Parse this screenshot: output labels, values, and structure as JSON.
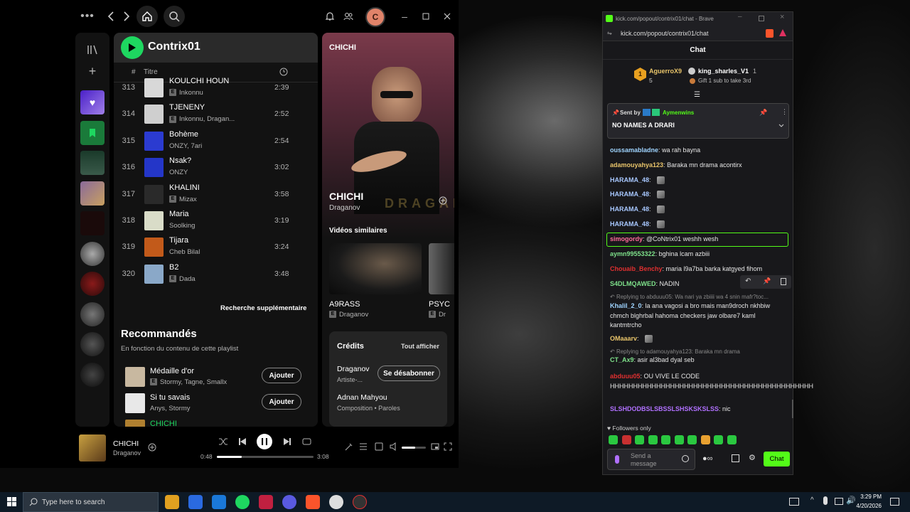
{
  "spotify": {
    "playlist_title": "Contrix01",
    "col_number": "#",
    "col_title": "Titre",
    "tracks": [
      {
        "num": "313",
        "title": "KOULCHI HOUN",
        "artist": "Inkonnu",
        "explicit": true,
        "duration": "2:39",
        "color": "#d8d8d8"
      },
      {
        "num": "314",
        "title": "TJENENY",
        "artist": "Inkonnu, Dragan...",
        "explicit": true,
        "duration": "2:52",
        "color": "#cfcfcf"
      },
      {
        "num": "315",
        "title": "Bohème",
        "artist": "ONZY, 7ari",
        "explicit": false,
        "duration": "2:54",
        "color": "#2b3bd0"
      },
      {
        "num": "316",
        "title": "Nsak?",
        "artist": "ONZY",
        "explicit": false,
        "duration": "3:02",
        "color": "#2436c8"
      },
      {
        "num": "317",
        "title": "KHALINI",
        "artist": "Mizax",
        "explicit": true,
        "duration": "3:58",
        "color": "#2a2a2a"
      },
      {
        "num": "318",
        "title": "Maria",
        "artist": "Soolking",
        "explicit": false,
        "duration": "3:19",
        "color": "#d9dcc8"
      },
      {
        "num": "319",
        "title": "Tijara",
        "artist": "Cheb Bilal",
        "explicit": false,
        "duration": "3:24",
        "color": "#c25a1a"
      },
      {
        "num": "320",
        "title": "B2",
        "artist": "Dada",
        "explicit": true,
        "duration": "3:48",
        "color": "#8aa8c8"
      }
    ],
    "more_search": "Recherche supplémentaire",
    "recommended_title": "Recommandés",
    "recommended_sub": "En fonction du contenu de cette playlist",
    "recommended": [
      {
        "title": "Médaille d'or",
        "artist": "Stormy, Tagne, Smallx",
        "explicit": true,
        "button": "Ajouter",
        "color": "#c8b8a0"
      },
      {
        "title": "Si tu savais",
        "artist": "Anys, Stormy",
        "explicit": false,
        "button": "Ajouter",
        "color": "#e8e8e8"
      },
      {
        "title": "CHICHI",
        "artist": "",
        "explicit": false,
        "button": "",
        "color": "#b08030"
      }
    ],
    "np_header": "CHICHI",
    "np_title": "CHICHI",
    "np_artist": "Draganov",
    "np_overlay_text": "DRAGANOV",
    "similar_title": "Vidéos similaires",
    "similar": [
      {
        "title": "A9RASS",
        "artist": "Draganov"
      },
      {
        "title": "PSYC",
        "artist": "Dr"
      }
    ],
    "credits_title": "Crédits",
    "credits_all": "Tout afficher",
    "credits": [
      {
        "name": "Draganov",
        "role": "Artiste-...",
        "button": "Se désabonner"
      },
      {
        "name": "Adnan Mahyou",
        "role": "Composition • Paroles",
        "button": ""
      }
    ],
    "player": {
      "title": "CHICHI",
      "artist": "Draganov",
      "elapsed": "0:48",
      "total": "3:08",
      "progress": 0.26,
      "volume": 0.55
    },
    "avatar_letter": "C"
  },
  "browser": {
    "tab_title": "kick.com/popout/contrix01/chat - Brave",
    "url": "kick.com/popout/contrix01/chat",
    "chat_title": "Chat",
    "leader1": {
      "rank": "1",
      "name": "AguerroX9",
      "count": "5"
    },
    "leader2": {
      "name": "king_sharles_V1",
      "count": "1",
      "note": "Gift 1 sub to take 3rd"
    },
    "pinned": {
      "sent_by": "Sent by",
      "author": "Aymenwins",
      "text": "NO NAMES A DRARI"
    },
    "messages": [
      {
        "user": "oussamabladne",
        "color": "#9fd4ff",
        "text": "wa rah bayna"
      },
      {
        "user": "adamouyahya123",
        "color": "#e8c46a",
        "text": "Baraka mn drama acontirx"
      },
      {
        "user": "HARAMA_48",
        "color": "#a8c8ff",
        "text": ""
      },
      {
        "user": "HARAMA_48",
        "color": "#a8c8ff",
        "text": ""
      },
      {
        "user": "HARAMA_48",
        "color": "#a8c8ff",
        "text": ""
      },
      {
        "user": "HARAMA_48",
        "color": "#a8c8ff",
        "text": ""
      },
      {
        "user": "simogordy",
        "color": "#ff6b9a",
        "text": "@CoNtrix01 weshh wesh"
      },
      {
        "user": "aymn99553322",
        "color": "#7ee08a",
        "text": "bghina lcam azbiii"
      },
      {
        "user": "Chouaib_Benchy",
        "color": "#e03030",
        "text": "maria l9a7ba barka katgyed fihom"
      },
      {
        "user": "S4DLMQAWED",
        "color": "#7ee08a",
        "text": "NADIN"
      },
      {
        "reply": "Replying to abduuu05: Wa nari ya zbiiii wa 4 snin mafr?toc..."
      },
      {
        "user": "Khalil_2_0",
        "color": "#9fd4ff",
        "text": "la ana vagosi a bro mais man9droch nkhbiw chmch blghrbal hahoma checkers jaw olbare7 kaml kantmtrcho"
      },
      {
        "user": "OMaaarv",
        "color": "#e8c46a",
        "text": ""
      },
      {
        "reply": "Replying to adamouyahya123: Baraka mn drama"
      },
      {
        "user": "CT_Ax9",
        "color": "#7ee08a",
        "text": "asir al3bad dyal seb"
      },
      {
        "user": "abduuu05",
        "color": "#e03030",
        "text": "OU VIVE LE CODE HHHHHHHHHHHHHHHHHHHHHHHHHHHHHHHHHHHHHHHHHHHH"
      },
      {
        "user": "SLSHDODBSLSBSSLSHSKSKSLSS",
        "color": "#b070ff",
        "text": "nic"
      }
    ],
    "followers_only": "Followers only",
    "send_placeholder": "Send a message",
    "chat_button": "Chat"
  },
  "taskbar": {
    "search_placeholder": "Type here to search",
    "time": "3:29 PM",
    "date": "4/20/2026"
  }
}
